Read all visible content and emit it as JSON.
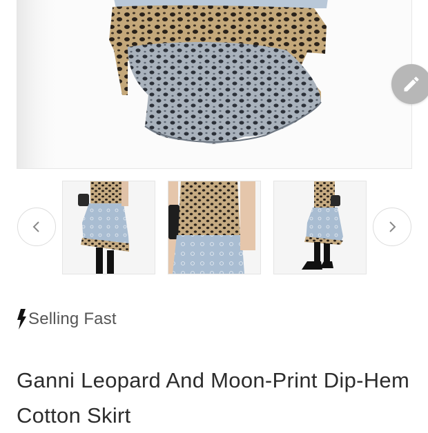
{
  "product": {
    "badge_label": "Selling Fast",
    "title": "Ganni Leopard And Moon-Print Dip-Hem Cotton Skirt"
  },
  "icons": {
    "edit": "pencil-icon",
    "prev": "chevron-left-icon",
    "next": "chevron-right-icon",
    "badge": "lightning-bolt-icon"
  },
  "colors": {
    "fab": "#b7b7b7",
    "text": "#2c2c2c",
    "muted": "#555555"
  },
  "gallery": {
    "thumbnail_count": 3
  }
}
